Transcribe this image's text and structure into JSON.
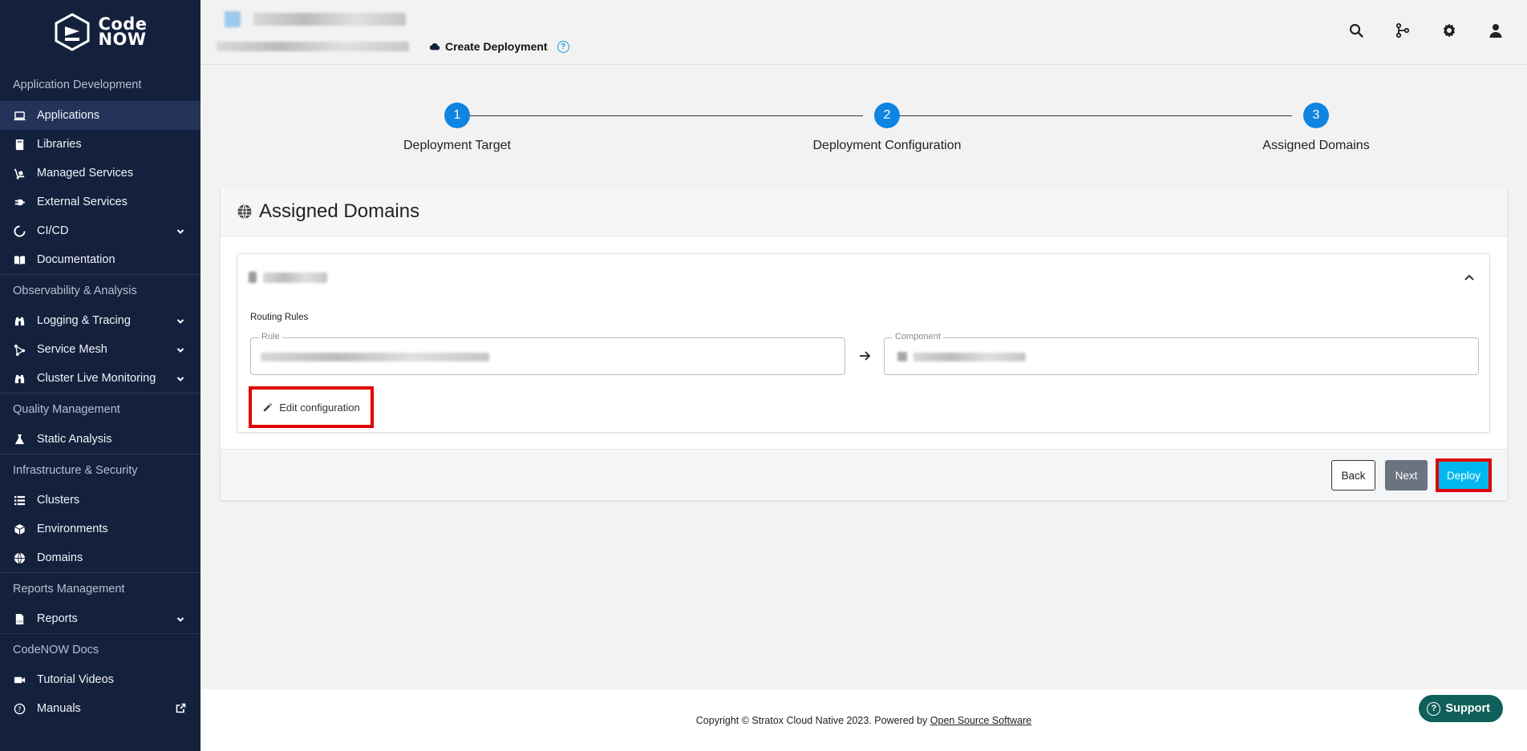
{
  "brand": {
    "line1": "Code",
    "line2": "NOW"
  },
  "sidebar": {
    "sections": [
      {
        "label": "Application Development",
        "items": [
          {
            "label": "Applications",
            "icon": "laptop-icon",
            "active": true
          },
          {
            "label": "Libraries",
            "icon": "book-icon"
          },
          {
            "label": "Managed Services",
            "icon": "dolly-icon"
          },
          {
            "label": "External Services",
            "icon": "plug-icon"
          },
          {
            "label": "CI/CD",
            "icon": "circle-notch-icon",
            "expandable": true
          },
          {
            "label": "Documentation",
            "icon": "book-open-icon"
          }
        ]
      },
      {
        "label": "Observability & Analysis",
        "items": [
          {
            "label": "Logging & Tracing",
            "icon": "binoculars-icon",
            "expandable": true
          },
          {
            "label": "Service Mesh",
            "icon": "mesh-icon",
            "expandable": true
          },
          {
            "label": "Cluster Live Monitoring",
            "icon": "binoculars-icon",
            "expandable": true
          }
        ]
      },
      {
        "label": "Quality Management",
        "items": [
          {
            "label": "Static Analysis",
            "icon": "flask-icon"
          }
        ]
      },
      {
        "label": "Infrastructure & Security",
        "items": [
          {
            "label": "Clusters",
            "icon": "list-icon"
          },
          {
            "label": "Environments",
            "icon": "cube-icon"
          },
          {
            "label": "Domains",
            "icon": "globe-icon"
          }
        ]
      },
      {
        "label": "Reports Management",
        "items": [
          {
            "label": "Reports",
            "icon": "csv-file-icon",
            "expandable": true
          }
        ]
      },
      {
        "label": "CodeNOW Docs",
        "items": [
          {
            "label": "Tutorial Videos",
            "icon": "video-icon"
          },
          {
            "label": "Manuals",
            "icon": "question-circle-icon",
            "external": true
          }
        ]
      }
    ]
  },
  "header": {
    "current_page": "Create Deployment",
    "icons": [
      "search-icon",
      "git-branch-icon",
      "gear-icon",
      "user-icon"
    ]
  },
  "stepper": {
    "steps": [
      {
        "number": "1",
        "label": "Deployment Target"
      },
      {
        "number": "2",
        "label": "Deployment Configuration"
      },
      {
        "number": "3",
        "label": "Assigned Domains"
      }
    ]
  },
  "card": {
    "title": "Assigned Domains",
    "routing_label": "Routing Rules",
    "rule_legend": "Rule",
    "component_legend": "Component",
    "edit_label": "Edit configuration"
  },
  "actions": {
    "back": "Back",
    "next": "Next",
    "deploy": "Deploy"
  },
  "footer": {
    "copyright": "Copyright © Stratox Cloud Native 2023. Powered by ",
    "link": "Open Source Software",
    "support": "Support"
  },
  "colors": {
    "sidebar_bg": "#14213d",
    "accent": "#0f84e0",
    "deploy": "#00b8ef",
    "highlight": "#e00000",
    "support": "#0f5f5a"
  }
}
